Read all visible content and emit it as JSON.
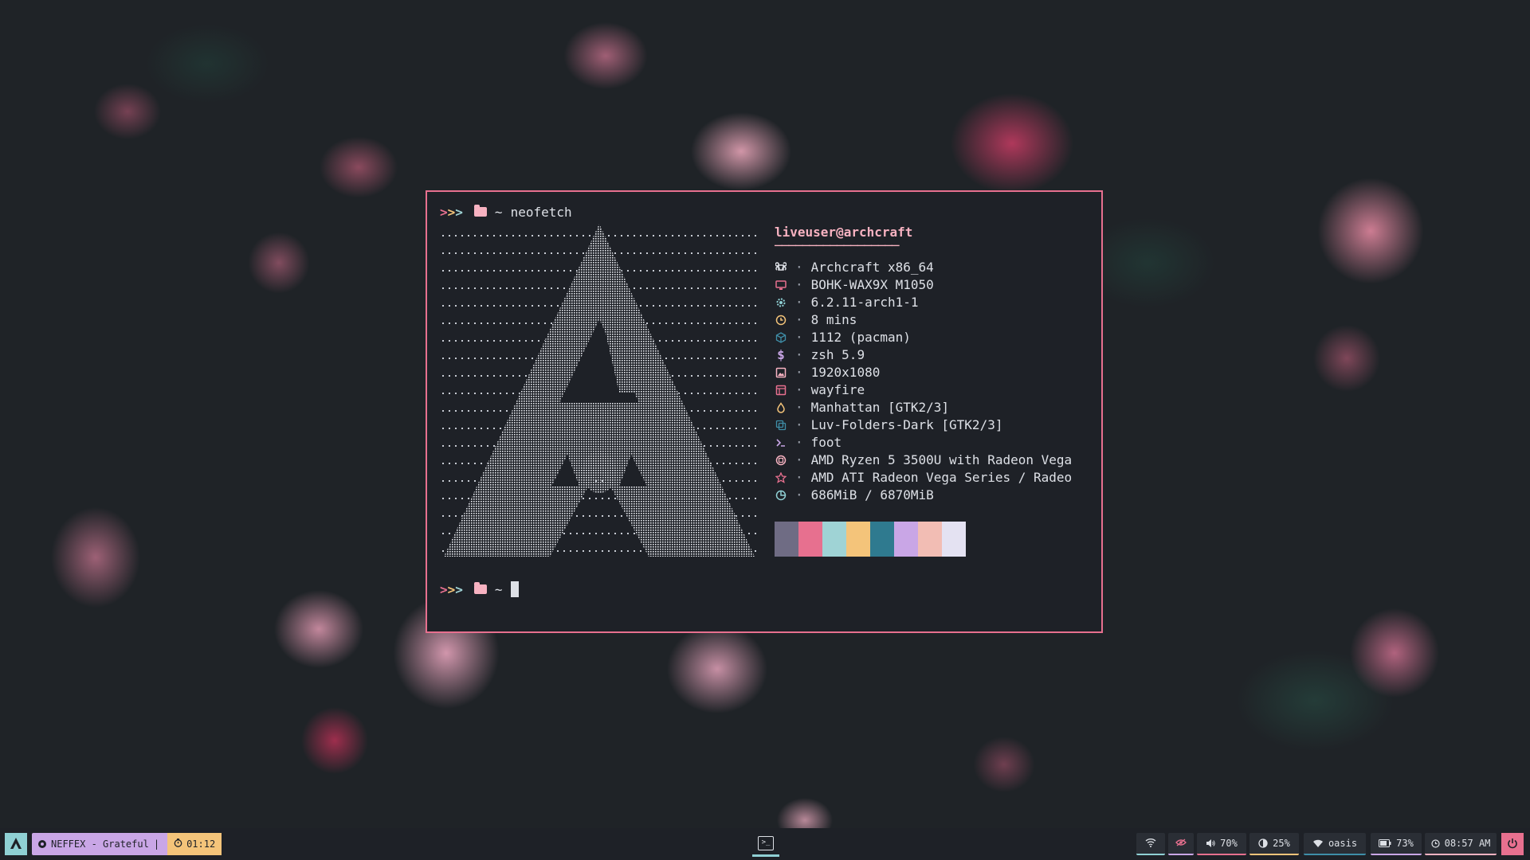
{
  "terminal": {
    "prompt_arrows": [
      ">",
      ">",
      ">"
    ],
    "prompt_tilde": "~",
    "command": "neofetch",
    "user_host": "liveuser@archcraft",
    "underline": "──────────────────",
    "separator": "·",
    "info": [
      {
        "icon": "command-key-icon",
        "color": "#dde0e6",
        "value": "Archcraft x86_64"
      },
      {
        "icon": "monitor-icon",
        "color": "#e7708f",
        "value": "BOHK-WAX9X M1050"
      },
      {
        "icon": "gear-icon",
        "color": "#8fd0d4",
        "value": "6.2.11-arch1-1"
      },
      {
        "icon": "clock-icon",
        "color": "#f4c47a",
        "value": "8 mins"
      },
      {
        "icon": "package-icon",
        "color": "#3f8ea8",
        "value": "1112 (pacman)"
      },
      {
        "icon": "dollar-icon",
        "color": "#c9a6e6",
        "value": "zsh 5.9"
      },
      {
        "icon": "image-icon",
        "color": "#f7b2c1",
        "value": "1920x1080"
      },
      {
        "icon": "window-icon",
        "color": "#e7708f",
        "value": "wayfire"
      },
      {
        "icon": "drop-icon",
        "color": "#f4c47a",
        "value": "Manhattan [GTK2/3]"
      },
      {
        "icon": "copy-icon",
        "color": "#3f8ea8",
        "value": "Luv-Folders-Dark [GTK2/3]"
      },
      {
        "icon": "terminal-prompt-icon",
        "color": "#c9a6e6",
        "value": "foot"
      },
      {
        "icon": "cpu-icon",
        "color": "#f7b2c1",
        "value": "AMD Ryzen 5 3500U with Radeon Vega"
      },
      {
        "icon": "star-icon",
        "color": "#e7708f",
        "value": "AMD ATI Radeon Vega Series / Radeo"
      },
      {
        "icon": "pie-icon",
        "color": "#8fd0d4",
        "value": "686MiB / 6870MiB"
      }
    ],
    "palette": [
      "#6f6c84",
      "#e7708f",
      "#9fd3d5",
      "#f4c47a",
      "#2f7a8f",
      "#c9a6e6",
      "#f2bdb4",
      "#e4e2f2"
    ]
  },
  "taskbar": {
    "launcher_icon": "archcraft-logo-icon",
    "media_title": "NEFFEX - Grateful",
    "media_divider": "|",
    "media_time": "01:12",
    "volume": "70%",
    "brightness": "25%",
    "network": "oasis",
    "battery": "73%",
    "clock": "08:57 AM"
  },
  "colors": {
    "accent": "#e7708f",
    "teal": "#8fd0d4",
    "background": "#1e2127"
  }
}
